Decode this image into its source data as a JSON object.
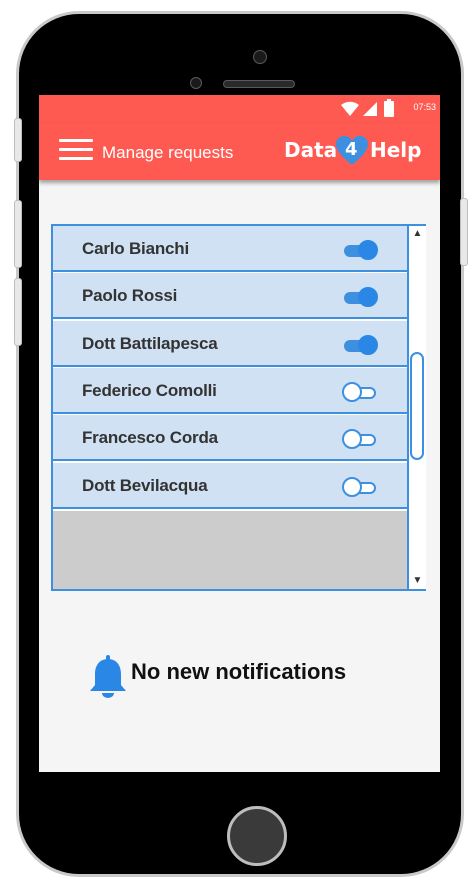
{
  "status_bar": {
    "time": "07:53",
    "icons": [
      "wifi-icon",
      "signal-icon",
      "battery-icon"
    ]
  },
  "app_bar": {
    "title": "Manage requests",
    "menu_icon": "hamburger-menu-icon",
    "logo": {
      "left": "Data",
      "middle": "4",
      "right": "Help"
    }
  },
  "requests": [
    {
      "name": "Carlo Bianchi",
      "enabled": true
    },
    {
      "name": "Paolo Rossi",
      "enabled": true
    },
    {
      "name": "Dott Battilapesca",
      "enabled": true
    },
    {
      "name": "Federico Comolli",
      "enabled": false
    },
    {
      "name": "Francesco Corda",
      "enabled": false
    },
    {
      "name": "Dott Bevilacqua",
      "enabled": false
    }
  ],
  "notifications": {
    "icon": "bell-icon",
    "text": "No new notifications"
  },
  "colors": {
    "accent": "#ff5a52",
    "primary": "#3d8fe0",
    "row_bg": "#cfe1f2"
  }
}
